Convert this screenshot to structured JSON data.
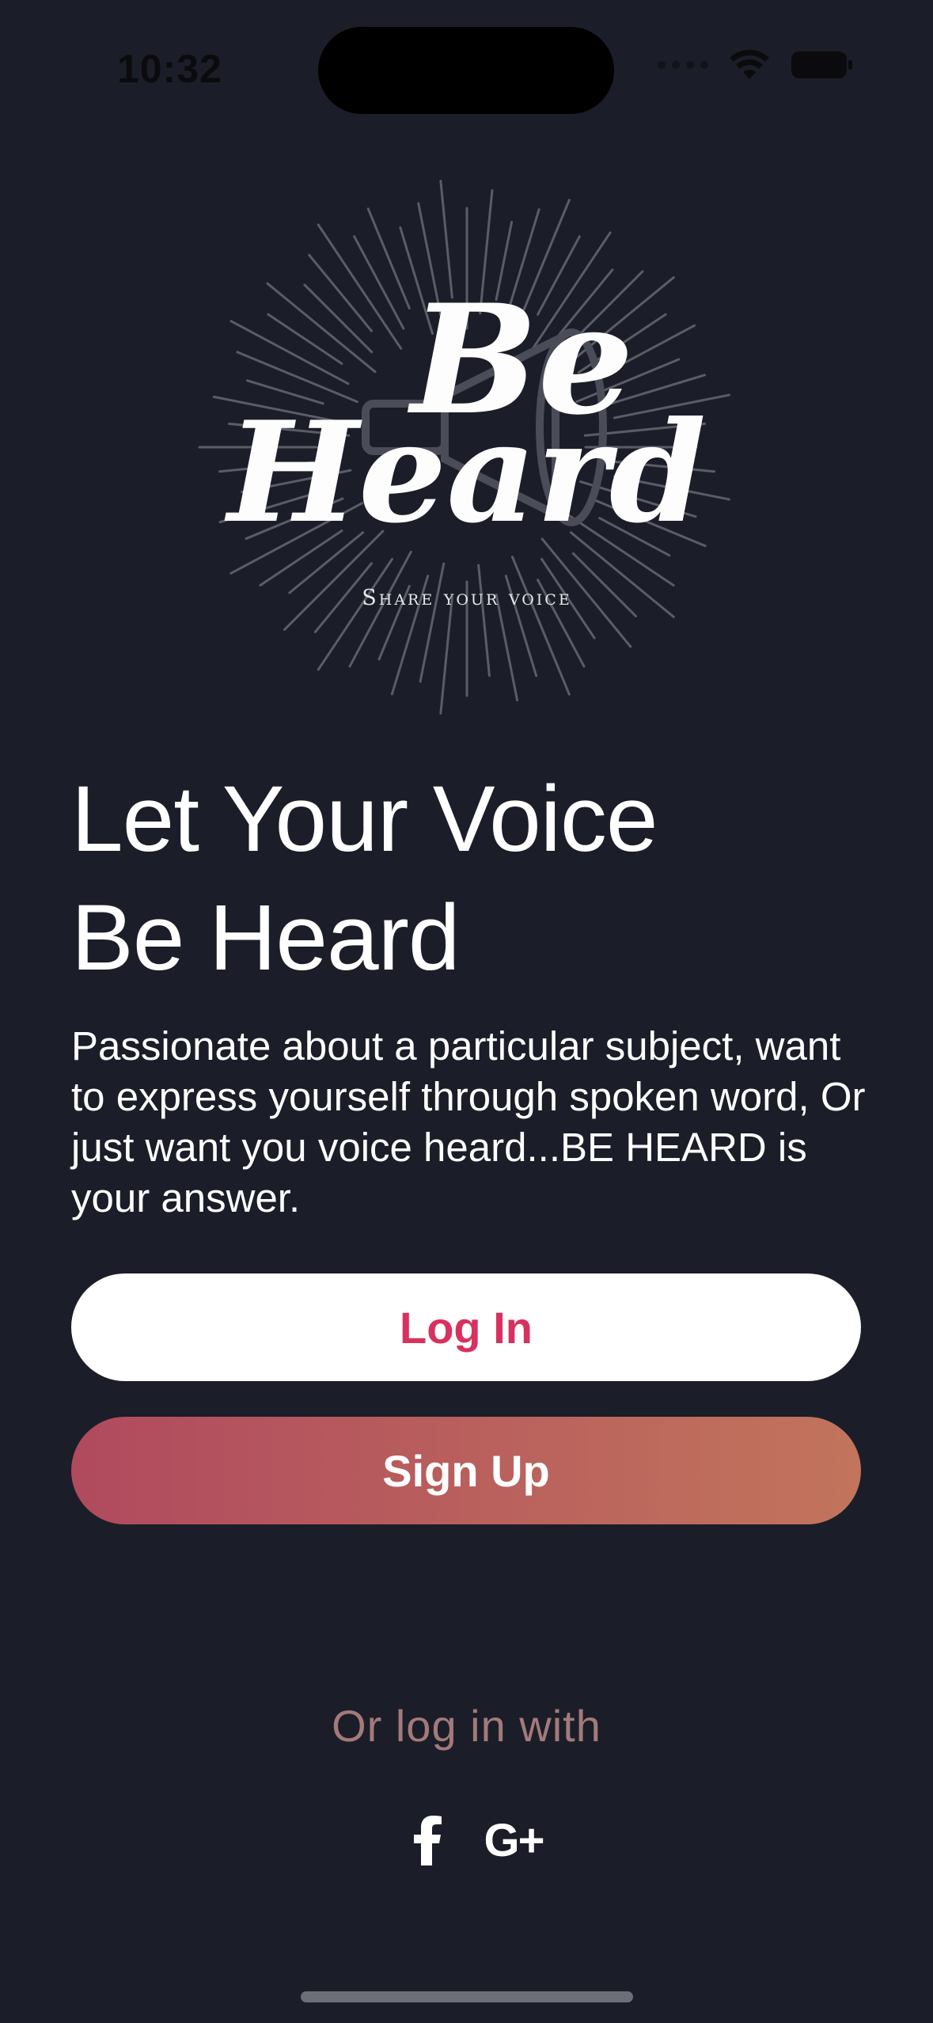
{
  "status_bar": {
    "time": "10:32"
  },
  "logo": {
    "script_line1": "Be",
    "script_line2": "Heard",
    "tagline": "Share your voice"
  },
  "headline": {
    "line1": "Let Your Voice",
    "line2": "Be Heard"
  },
  "description": "Passionate about a particular subject, want to express yourself through spoken word, Or just want you voice heard...BE HEARD is your answer.",
  "buttons": {
    "login": "Log In",
    "signup": "Sign Up"
  },
  "alt_login": {
    "label": "Or log in with",
    "providers": [
      {
        "name": "facebook",
        "icon": "facebook-icon",
        "glyph": "f"
      },
      {
        "name": "google-plus",
        "icon": "google-plus-icon",
        "glyph": "G+"
      }
    ]
  },
  "colors": {
    "background": "#1b1e28",
    "login_text": "#d8315f",
    "signup_gradient_start": "#b04a5e",
    "signup_gradient_end": "#c2745c",
    "alt_login_text": "#a37a7a"
  }
}
